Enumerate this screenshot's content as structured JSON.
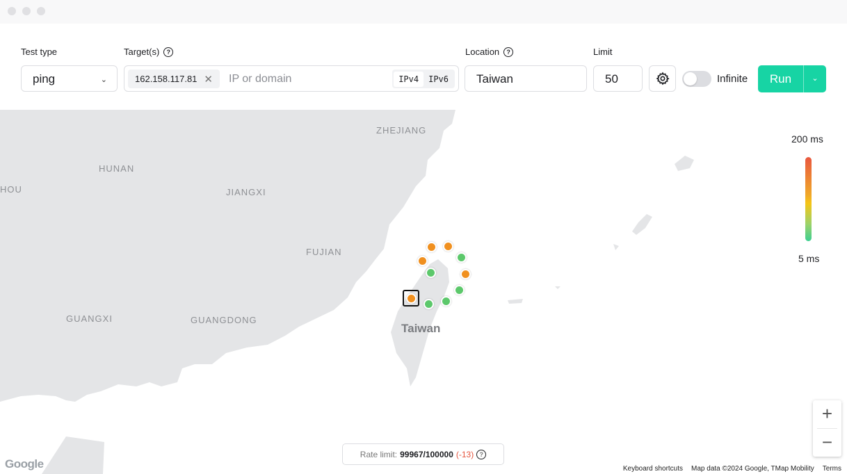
{
  "toolbar": {
    "test_type_label": "Test type",
    "test_type_value": "ping",
    "targets_label": "Target(s)",
    "target_chip": "162.158.117.81",
    "target_placeholder": "IP or domain",
    "ipv4": "IPv4",
    "ipv6": "IPv6",
    "location_label": "Location",
    "location_value": "Taiwan",
    "limit_label": "Limit",
    "limit_value": "50",
    "infinite_label": "Infinite",
    "infinite_on": false,
    "run_label": "Run",
    "accent_color": "#17d4a4"
  },
  "map": {
    "labels": {
      "zhejiang": "ZHEJIANG",
      "hunan": "HUNAN",
      "jiangxi": "JIANGXI",
      "hou": "HOU",
      "fujian": "FUJIAN",
      "guangxi": "GUANGXI",
      "guangdong": "GUANGDONG",
      "taiwan": "Taiwan"
    },
    "probe_status": [
      "orange",
      "orange",
      "orange",
      "green",
      "green",
      "orange",
      "green",
      "orange",
      "green",
      "green"
    ],
    "status_colors": {
      "orange": "#f0901f",
      "green": "#5cc86b"
    }
  },
  "legend": {
    "max": "200 ms",
    "min": "5 ms"
  },
  "zoom": {
    "in": "+",
    "out": "−"
  },
  "rate_limit": {
    "label": "Rate limit:",
    "value": "99967/100000",
    "delta": "(-13)"
  },
  "attribution": {
    "google": "Google",
    "shortcuts": "Keyboard shortcuts",
    "map_data": "Map data ©2024 Google, TMap Mobility",
    "terms": "Terms"
  }
}
